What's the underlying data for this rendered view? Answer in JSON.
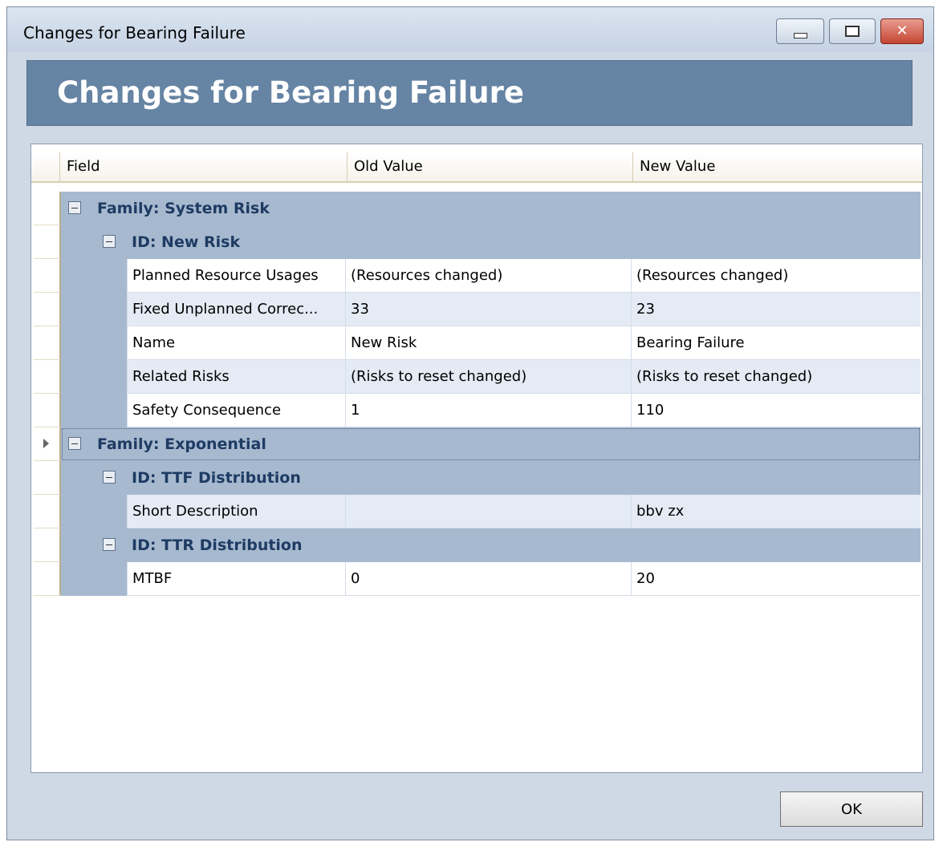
{
  "window": {
    "title": "Changes for Bearing Failure",
    "minimize_icon": "minimize-icon",
    "maximize_icon": "maximize-icon",
    "close_icon": "close-icon",
    "close_glyph": "✕"
  },
  "header": {
    "title": "Changes for Bearing Failure"
  },
  "grid": {
    "columns": [
      "Field",
      "Old Value",
      "New Value"
    ],
    "groups": {
      "family_system_risk": "Family: System Risk",
      "id_new_risk": "ID: New Risk",
      "family_exponential": "Family: Exponential",
      "id_ttf_distribution": "ID: TTF Distribution",
      "id_ttr_distribution": "ID: TTR Distribution"
    },
    "rows": [
      {
        "field": "Planned Resource Usages",
        "old": "(Resources changed)",
        "new": "(Resources changed)"
      },
      {
        "field": "Fixed Unplanned Correc...",
        "old": "33",
        "new": "23"
      },
      {
        "field": "Name",
        "old": "New Risk",
        "new": "Bearing Failure"
      },
      {
        "field": "Related Risks",
        "old": "(Risks to reset changed)",
        "new": "(Risks to reset changed)"
      },
      {
        "field": "Safety Consequence",
        "old": "1",
        "new": "110"
      },
      {
        "field": "Short Description",
        "old": "",
        "new": "bbv zx"
      },
      {
        "field": "MTBF",
        "old": "0",
        "new": "20"
      }
    ]
  },
  "footer": {
    "ok_label": "OK"
  },
  "colors": {
    "header_band": "#6684a3",
    "group_row": "#a7b9cf",
    "alt_row": "#e4ebf4",
    "group_text": "#1e3b63"
  }
}
